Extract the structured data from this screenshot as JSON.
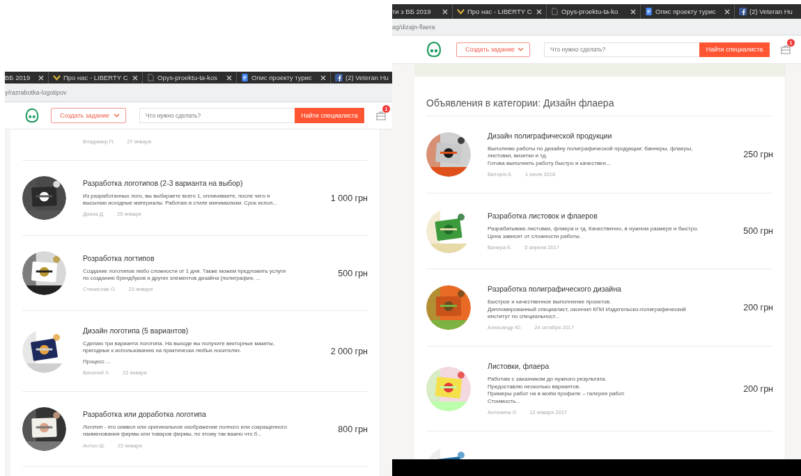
{
  "panels": [
    {
      "tabs": [
        {
          "label": "ВБ 2019",
          "kind": "plain",
          "closable": true
        },
        {
          "label": "Про нас - LIBERTY C",
          "kind": "chevron",
          "closable": true
        },
        {
          "label": "Opys-proektu-ta-kos",
          "kind": "file",
          "closable": true
        },
        {
          "label": "Опис проекту турис",
          "kind": "docs",
          "closable": true
        },
        {
          "label": "(2) Veteran Hu",
          "kind": "facebook",
          "closable": false
        }
      ],
      "url": "y/razrabotka-logotipov",
      "header": {
        "create_button": "Создать задание",
        "search_placeholder": "Что нужно сделать?",
        "search_button": "Найти специалиста",
        "cart_badge": "1"
      },
      "listings": [
        {
          "kind": "meta_only",
          "author": "Владимир П.",
          "date": "27 января"
        },
        {
          "kind": "full",
          "title": "Разработка логотипов (2-3 варианта на выбор)",
          "description": [
            "Из разработанных лого, вы выбираете всего 1, оплачиваете, после чего я\nвысылаю исходные материалы. Работаю в стиле минимализм. Срок испол..."
          ],
          "author": "Диана Д.",
          "date": "25 января",
          "price": "1 000 грн"
        },
        {
          "kind": "full",
          "title": "Розработка логтипов",
          "description": [
            "Создание логотипов любо сложности от 1 дня. Также можем предложить услуги\nпо созданию брендбуков и других элементов дизайна (полиграфия, ..."
          ],
          "author": "Станислав О.",
          "date": "23 января",
          "price": "500 грн"
        },
        {
          "kind": "full",
          "title": "Дизайн логотипа (5 вариантов)",
          "description": [
            "Сделаю три варианта логотипа. На выходе вы получите векторные макеты,\nпригодные к использованию на практически любых носителях.",
            "Процесс ..."
          ],
          "author": "Василий Х.",
          "date": "22 января",
          "price": "2 000 грн"
        },
        {
          "kind": "full",
          "title": "Разработка или доработка логотипа",
          "description": [
            "Логотип - это символ или оригинальное изображение полного или сокращенного\nнаименования фирмы или товаров фирмы, по этому так важно что б..."
          ],
          "author": "Антон Ш.",
          "date": "22 января",
          "price": "800 грн"
        }
      ]
    },
    {
      "tabs": [
        {
          "label": "ти з ВБ 2019",
          "kind": "plain",
          "closable": true
        },
        {
          "label": "Про нас - LIBERTY C",
          "kind": "chevron",
          "closable": true
        },
        {
          "label": "Opys-proektu-ta-ko",
          "kind": "file",
          "closable": true
        },
        {
          "label": "Опис проекту турис",
          "kind": "docs",
          "closable": true
        },
        {
          "label": "(2) Veteran Hu",
          "kind": "facebook",
          "closable": false
        }
      ],
      "url": "ag/dizajn-flaera",
      "header": {
        "create_button": "Создать задание",
        "search_placeholder": "Что нужно сделать?",
        "search_button": "Найти специалиста",
        "cart_badge": "1"
      },
      "heading": "Объявления в категории: Дизайн флаера",
      "listings": [
        {
          "kind": "full",
          "title": "Дизайн полиграфической продукции",
          "description": [
            "Выполняю работы по дизайну полиграфической продукции: баннеры, флаеры,\nлистовки, визитки и тд.\nГотова выполнить работу быстро и качествен..."
          ],
          "author": "Вікторія К.",
          "date": "1 июля 2018",
          "price": "250 грн"
        },
        {
          "kind": "full",
          "title": "Разработка листовок и флаеров",
          "description": [
            "Разрабатываю листовки, флаера и тд. Качественно, в нужном размере и быстро.\nЦена зависит от сложности работы."
          ],
          "author": "Валера Е.",
          "date": "5 апреля 2017",
          "price": "500 грн"
        },
        {
          "kind": "full",
          "title": "Разработка полиграфического дизайна",
          "description": [
            "Быстрое и качественное выполнение проектов.\nДипломированный специалист, окончил КПИ Издательско-полиграфический\nинститут по специальност..."
          ],
          "author": "Александр Ю.",
          "date": "24 октября 2017",
          "price": "200 грн"
        },
        {
          "kind": "full",
          "title": "Листовки, флаера",
          "description": [
            "Работаю с заказчиком до нужного результата.\nПредоставлю несколько вариантов.\nПримеры работ на в моём профиле – галерея работ.\nСтоимость..."
          ],
          "author": "Антонина Л.",
          "date": "12 января 2017",
          "price": "200 грн"
        },
        {
          "kind": "picture_only"
        }
      ]
    }
  ]
}
